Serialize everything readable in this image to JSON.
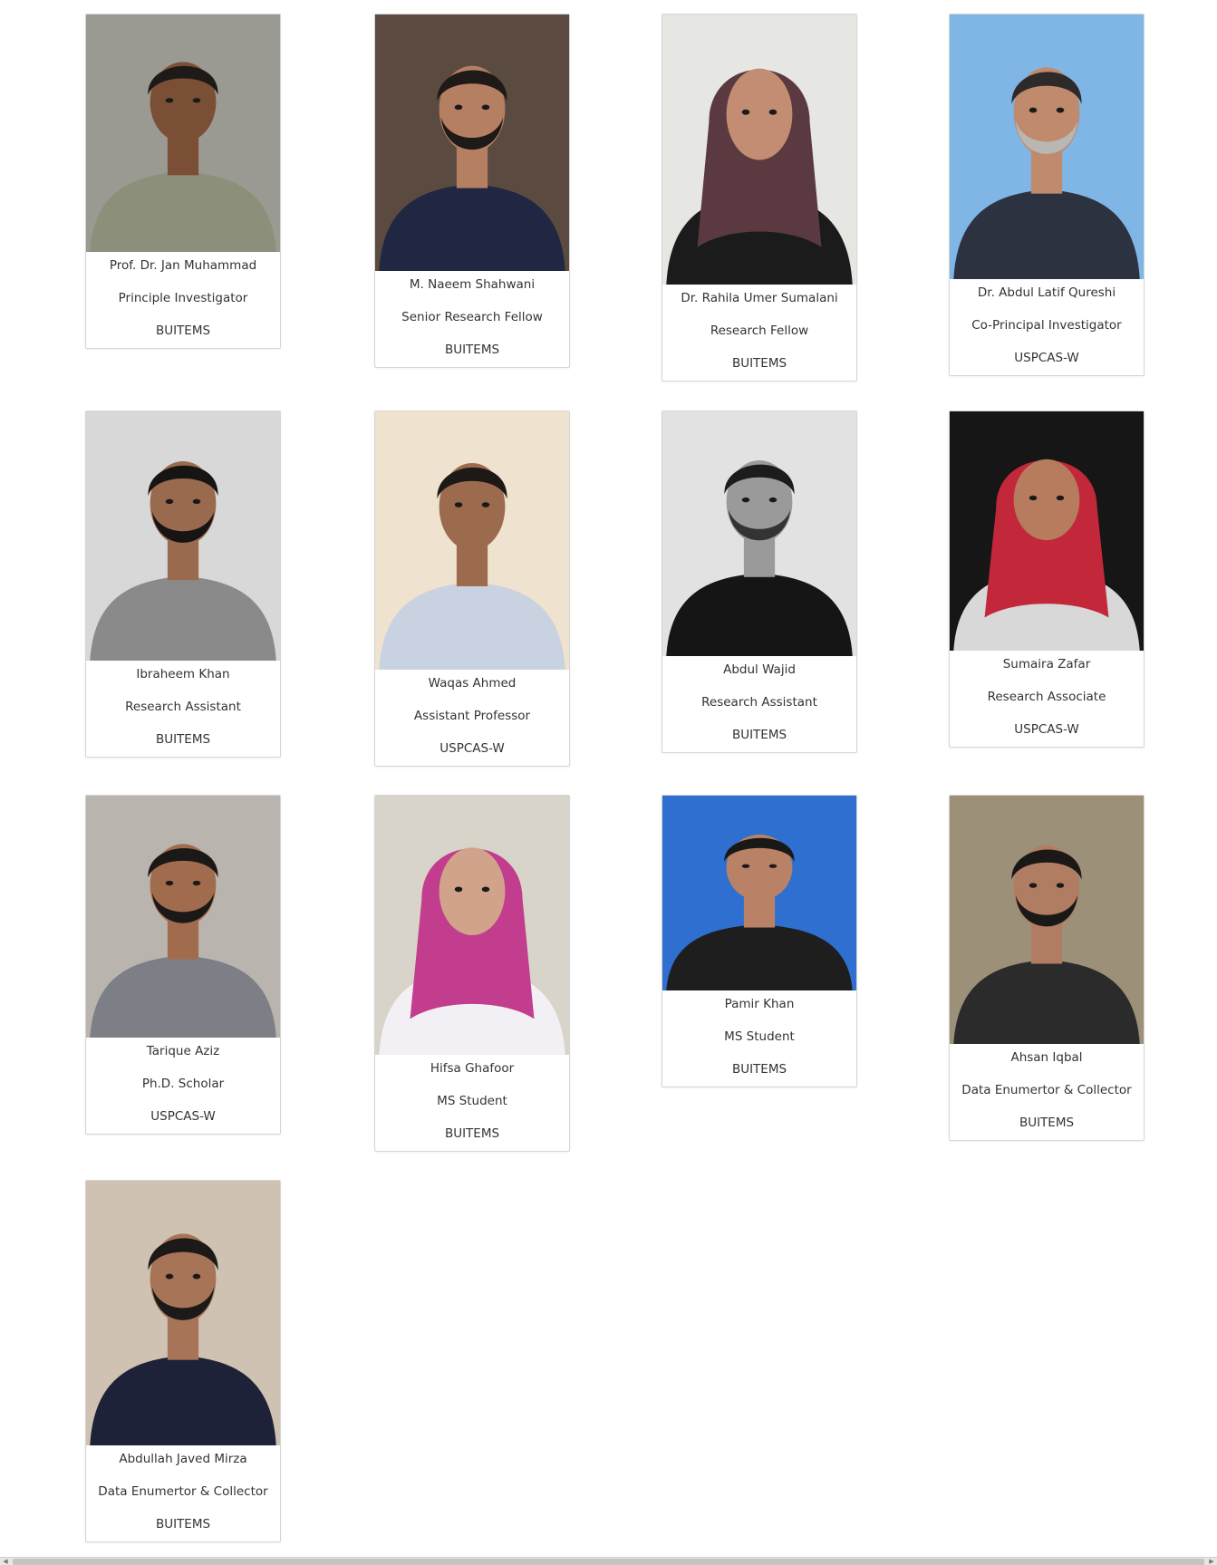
{
  "members": [
    {
      "name": "Prof. Dr. Jan Muhammad",
      "role": "Principle Investigator",
      "org": "BUITEMS",
      "photo": {
        "bg": "#9a9a92",
        "skin": "#7a4f35",
        "hair": "#1e1a18",
        "cloth": "#8c8f7a",
        "beard": false
      }
    },
    {
      "name": "M. Naeem Shahwani",
      "role": "Senior Research Fellow",
      "org": "BUITEMS",
      "photo": {
        "bg": "#5b4a3f",
        "skin": "#b57f62",
        "hair": "#1d1a17",
        "cloth": "#1f2742",
        "beard": true
      }
    },
    {
      "name": "Dr. Rahila Umer Sumalani",
      "role": "Research Fellow",
      "org": "BUITEMS",
      "photo": {
        "bg": "#e6e6e3",
        "skin": "#c28d72",
        "hair": "#4a3b38",
        "cloth": "#1b1b1b",
        "beard": false,
        "scarf": "#5a3a40"
      }
    },
    {
      "name": "Dr. Abdul Latif Qureshi",
      "role": "Co-Principal Investigator",
      "org": "USPCAS-W",
      "photo": {
        "bg": "#7fb6e6",
        "skin": "#c08a6c",
        "hair": "#2e2a2a",
        "cloth": "#2d3240",
        "beard": true,
        "beardColor": "#b9b7b3"
      }
    },
    {
      "name": "Ibraheem Khan",
      "role": "Research Assistant",
      "org": "BUITEMS",
      "photo": {
        "bg": "#d8d8d8",
        "skin": "#9a6a4e",
        "hair": "#171514",
        "cloth": "#8a8a8a",
        "beard": true
      }
    },
    {
      "name": "Waqas Ahmed",
      "role": "Assistant Professor",
      "org": "USPCAS-W",
      "photo": {
        "bg": "#efe3cf",
        "skin": "#9c6a4c",
        "hair": "#1c1916",
        "cloth": "#c9d2e0",
        "beard": false
      }
    },
    {
      "name": "Abdul Wajid",
      "role": "Research Assistant",
      "org": "BUITEMS",
      "photo": {
        "bg": "#e2e2e2",
        "skin": "#9a9a9a",
        "hair": "#1c1c1c",
        "cloth": "#151515",
        "beard": true,
        "beardColor": "#333333"
      }
    },
    {
      "name": "Sumaira Zafar",
      "role": "Research Associate",
      "org": "USPCAS-W",
      "photo": {
        "bg": "#161616",
        "skin": "#b77b5e",
        "hair": "#1d1d1d",
        "cloth": "#d8d8d8",
        "beard": false,
        "scarf": "#c2283a"
      }
    },
    {
      "name": "Tarique Aziz",
      "role": "Ph.D. Scholar",
      "org": "USPCAS-W",
      "photo": {
        "bg": "#b9b4ae",
        "skin": "#a16c4e",
        "hair": "#1b1917",
        "cloth": "#7c7f86",
        "beard": true
      }
    },
    {
      "name": "Hifsa Ghafoor",
      "role": "MS Student",
      "org": "BUITEMS",
      "photo": {
        "bg": "#d9d4c9",
        "skin": "#d1a38a",
        "hair": "#2a2220",
        "cloth": "#f2f0f4",
        "beard": false,
        "scarf": "#c23d8e"
      }
    },
    {
      "name": "Pamir Khan",
      "role": "MS Student",
      "org": "BUITEMS",
      "photo": {
        "bg": "#2f6fcf",
        "skin": "#b98266",
        "hair": "#1a1816",
        "cloth": "#1e1e1e",
        "beard": false
      }
    },
    {
      "name": "Ahsan Iqbal",
      "role": "Data Enumertor & Collector",
      "org": "BUITEMS",
      "photo": {
        "bg": "#9d9079",
        "skin": "#b07d63",
        "hair": "#1b1917",
        "cloth": "#2b2b2b",
        "beard": true
      }
    },
    {
      "name": "Abdullah Javed Mirza",
      "role": "Data Enumertor & Collector",
      "org": "BUITEMS",
      "photo": {
        "bg": "#cfc2b3",
        "skin": "#a87457",
        "hair": "#1c1a18",
        "cloth": "#1d2238",
        "beard": true
      }
    }
  ]
}
